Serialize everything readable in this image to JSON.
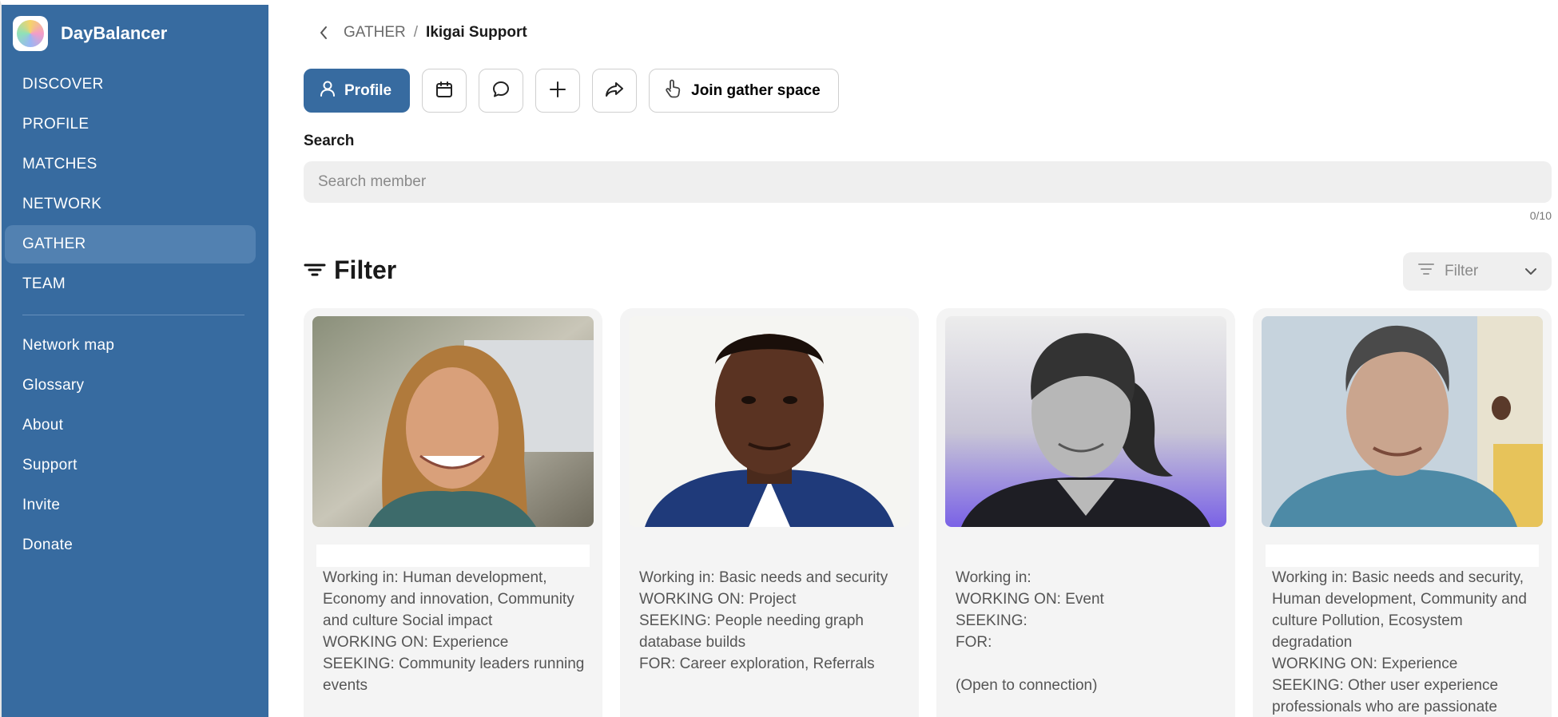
{
  "app": {
    "name": "DayBalancer"
  },
  "sidebar": {
    "primary": [
      {
        "label": "DISCOVER",
        "active": false
      },
      {
        "label": "PROFILE",
        "active": false
      },
      {
        "label": "MATCHES",
        "active": false
      },
      {
        "label": "NETWORK",
        "active": false
      },
      {
        "label": "GATHER",
        "active": true
      },
      {
        "label": "TEAM",
        "active": false
      }
    ],
    "secondary": [
      {
        "label": "Network map"
      },
      {
        "label": "Glossary"
      },
      {
        "label": "About"
      },
      {
        "label": "Support"
      },
      {
        "label": "Invite"
      },
      {
        "label": "Donate"
      }
    ]
  },
  "breadcrumb": {
    "parent": "GATHER",
    "separator": "/",
    "current": "Ikigai Support"
  },
  "toolbar": {
    "profile_label": "Profile",
    "join_label": "Join gather space",
    "icons": [
      "person-icon",
      "calendar-icon",
      "chat-icon",
      "plus-icon",
      "share-icon",
      "hand-pointer-icon"
    ]
  },
  "search": {
    "label": "Search",
    "placeholder": "Search member",
    "value": "",
    "count": "0/10"
  },
  "filter": {
    "title": "Filter",
    "dropdown_label": "Filter"
  },
  "members": [
    {
      "text": "Working in: Human development, Economy and innovation, Community and culture Social impact\nWORKING ON: Experience\nSEEKING: Community leaders running events"
    },
    {
      "text": "Working in: Basic needs and security\nWORKING ON: Project\nSEEKING: People needing graph database builds\nFOR: Career exploration, Referrals"
    },
    {
      "text": "Working in:\nWORKING ON: Event\nSEEKING:\nFOR:\n\n(Open to connection)"
    },
    {
      "text": "Working in: Basic needs and security, Human development, Community and culture  Pollution, Ecosystem degradation\nWORKING ON: Experience\nSEEKING: Other user experience professionals who are passionate"
    }
  ],
  "colors": {
    "brand": "#376ba0",
    "active_nav": "#5281b1",
    "card_bg": "#f4f4f4",
    "input_bg": "#efefef"
  }
}
